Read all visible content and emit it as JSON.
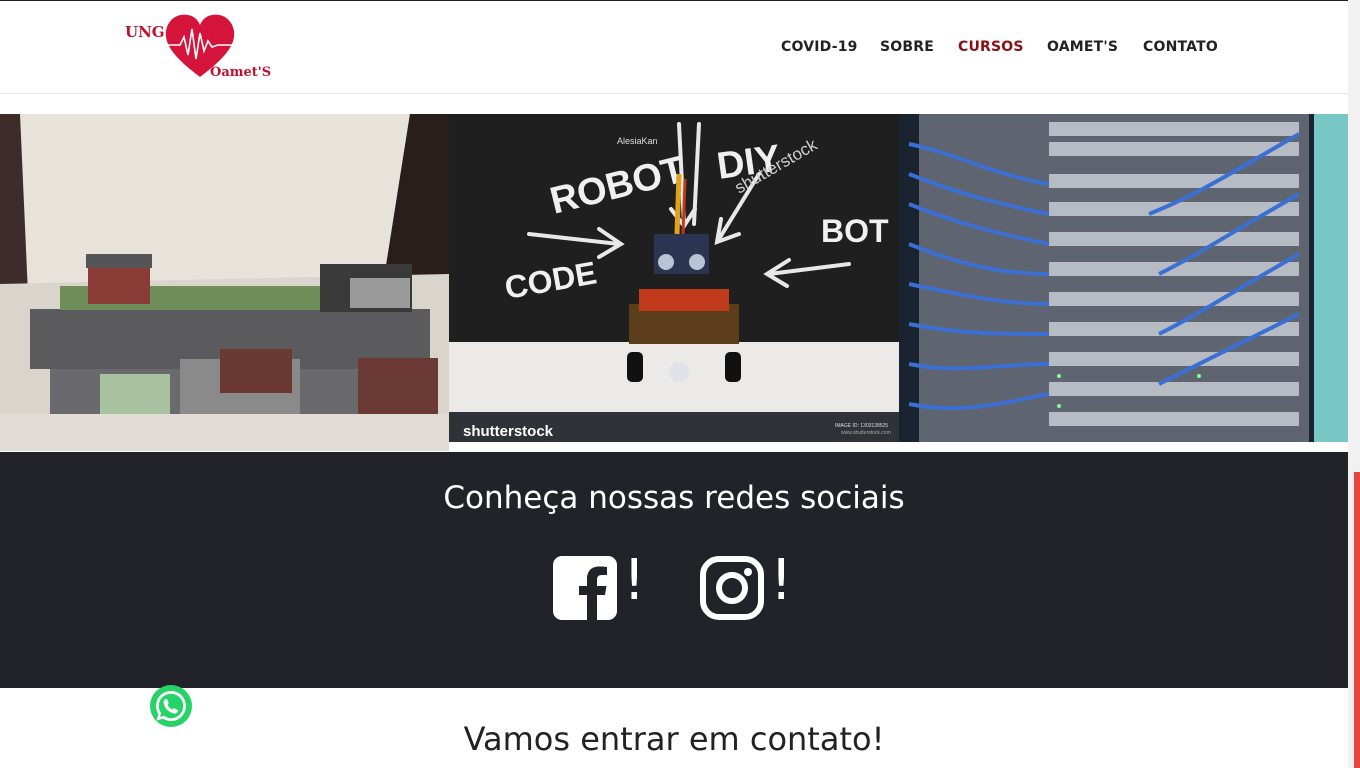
{
  "brand": {
    "top_text": "UNG",
    "bottom_text": "Oamet'S",
    "accent": "#c0112f"
  },
  "nav": {
    "items": [
      {
        "label": "COVID-19"
      },
      {
        "label": "SOBRE"
      },
      {
        "label": "CURSOS",
        "active": true
      },
      {
        "label": "OAMET'S"
      },
      {
        "label": "CONTATO"
      }
    ],
    "active_color": "#8b0e12"
  },
  "gallery": {
    "images": [
      {
        "description": "city model photo"
      },
      {
        "description": "robot chalkboard photo",
        "words": [
          "ROBOT",
          "DIY",
          "BOT",
          "CODE"
        ],
        "watermark": "shutterstock",
        "author": "AlesiaKan",
        "image_id": "IMAGE ID: 1303138525",
        "site": "www.shutterstock.com"
      },
      {
        "description": "server rack photo"
      }
    ]
  },
  "social": {
    "title": "Conheça nossas redes sociais",
    "facebook": {
      "icon": "facebook-icon",
      "suffix": "!"
    },
    "instagram": {
      "icon": "instagram-icon",
      "suffix": "!"
    },
    "background": "#212329"
  },
  "contact": {
    "title": "Vamos entrar em contato!"
  },
  "whatsapp": {
    "icon": "whatsapp-icon",
    "color": "#25d366"
  }
}
